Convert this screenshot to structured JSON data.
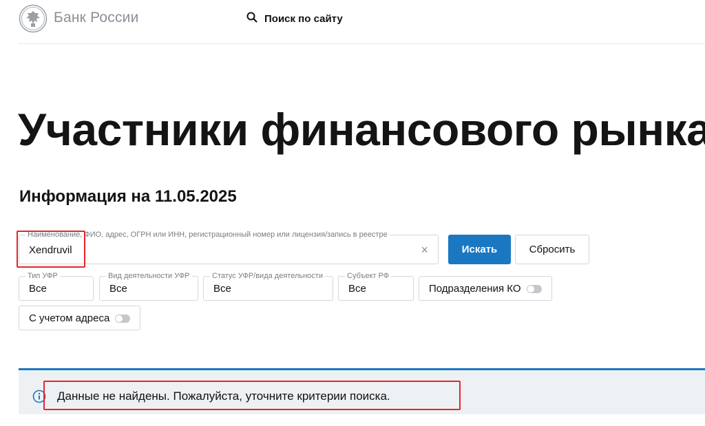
{
  "header": {
    "logo_text": "Банк России",
    "search_label": "Поиск по сайту"
  },
  "page": {
    "title": "Участники финансового рынка",
    "info_date": "Информация на 11.05.2025"
  },
  "search_form": {
    "name_field": {
      "label": "Наименование, ФИО, адрес, ОГРН или ИНН, регистрационный номер или лицензия/запись в реестре",
      "value": "Xendruvil",
      "clear_symbol": "×"
    },
    "search_button": "Искать",
    "reset_button": "Сбросить",
    "filters": {
      "type": {
        "label": "Тип УФР",
        "value": "Все"
      },
      "activity": {
        "label": "Вид деятельности УФР",
        "value": "Все"
      },
      "status": {
        "label": "Статус УФР/вида деятельности",
        "value": "Все"
      },
      "region": {
        "label": "Субъект РФ",
        "value": "Все"
      }
    },
    "toggles": {
      "ko_divisions": {
        "label": "Подразделения КО",
        "on": false
      },
      "with_address": {
        "label": "С учетом адреса",
        "on": false
      }
    }
  },
  "alert": {
    "icon": "info-icon",
    "text": "Данные не найдены. Пожалуйста, уточните критерии поиска."
  },
  "colors": {
    "primary": "#1a78c2",
    "annotation": "#e8232b",
    "alert_bg": "#eef1f4",
    "muted": "#8a8f96"
  }
}
